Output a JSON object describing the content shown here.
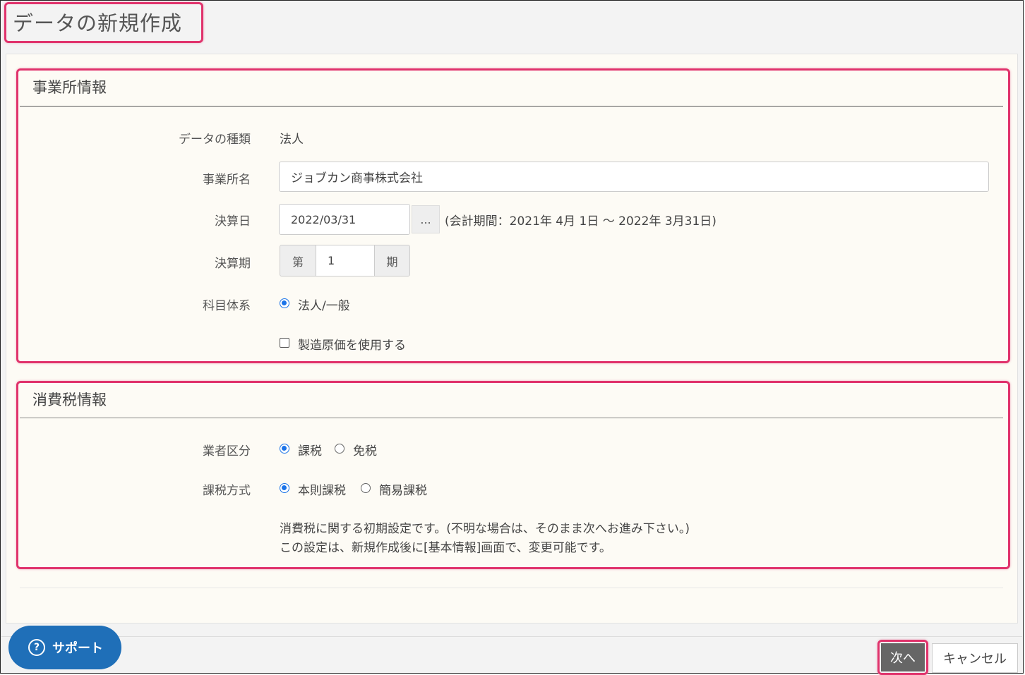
{
  "page": {
    "title": "データの新規作成"
  },
  "office_section": {
    "title": "事業所情報",
    "data_type": {
      "label": "データの種類",
      "value": "法人"
    },
    "office_name": {
      "label": "事業所名",
      "value": "ジョブカン商事株式会社"
    },
    "closing_date": {
      "label": "決算日",
      "value": "2022/03/31",
      "picker_label": "...",
      "period_note": "(会計期間：2021年 4月 1日 ～ 2022年 3月31日)"
    },
    "fiscal_term": {
      "label": "決算期",
      "prefix": "第",
      "value": "1",
      "suffix": "期"
    },
    "account_system": {
      "label": "科目体系",
      "option": "法人/一般",
      "selected": true
    },
    "manufacturing_cost": {
      "label": "製造原価を使用する",
      "checked": false
    }
  },
  "tax_section": {
    "title": "消費税情報",
    "business_type": {
      "label": "業者区分",
      "options": [
        "課税",
        "免税"
      ],
      "selected": "課税"
    },
    "tax_method": {
      "label": "課税方式",
      "options": [
        "本則課税",
        "簡易課税"
      ],
      "selected": "本則課税"
    },
    "note_line1": "消費税に関する初期設定です。(不明な場合は、そのまま次へお進み下さい。)",
    "note_line2": "この設定は、新規作成後に[基本情報]画面で、変更可能です。"
  },
  "footer": {
    "support_label": "サポート",
    "support_icon": "question-icon",
    "next_label": "次へ",
    "cancel_label": "キャンセル"
  },
  "colors": {
    "highlight": "#e0336c",
    "accent": "#1a73e8",
    "support": "#1f6fb8",
    "next_button": "#666666"
  }
}
